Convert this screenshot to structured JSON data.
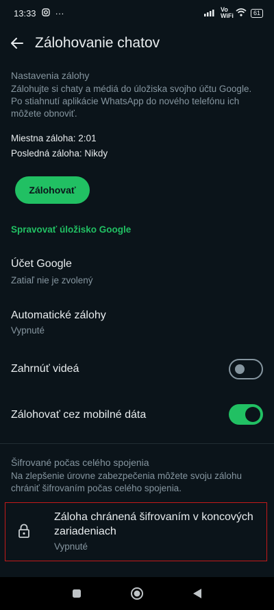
{
  "status_bar": {
    "time": "13:33",
    "battery": "61",
    "network_label": "Vo WiFi",
    "more_icon": "···"
  },
  "app_bar": {
    "title": "Zálohovanie chatov"
  },
  "backup_settings": {
    "section_title": "Nastavenia zálohy",
    "description": "Zálohujte si chaty a médiá do úložiska svojho účtu Google. Po stiahnutí aplikácie WhatsApp do nového telefónu ich môžete obnoviť.",
    "local_backup": "Miestna záloha: 2:01",
    "last_backup": "Posledná záloha: Nikdy",
    "backup_button": "Zálohovať"
  },
  "google_storage": {
    "manage_link": "Spravovať úložisko Google",
    "account_title": "Účet Google",
    "account_value": "Zatiaľ nie je zvolený",
    "auto_backup_title": "Automatické zálohy",
    "auto_backup_value": "Vypnuté",
    "include_videos_label": "Zahrnúť videá",
    "include_videos_on": false,
    "mobile_data_label": "Zálohovať cez mobilné dáta",
    "mobile_data_on": true
  },
  "e2e": {
    "section_title": "Šifrované počas celého spojenia",
    "description": "Na zlepšenie úrovne zabezpečenia môžete svoju zálohu chrániť šifrovaním počas celého spojenia.",
    "item_title": "Záloha chránená šifrovaním v koncových zariadeniach",
    "item_value": "Vypnuté"
  },
  "colors": {
    "background": "#0b141a",
    "accent": "#21c063",
    "secondary_text": "#8696a0",
    "highlight_border": "#c41a1a"
  }
}
